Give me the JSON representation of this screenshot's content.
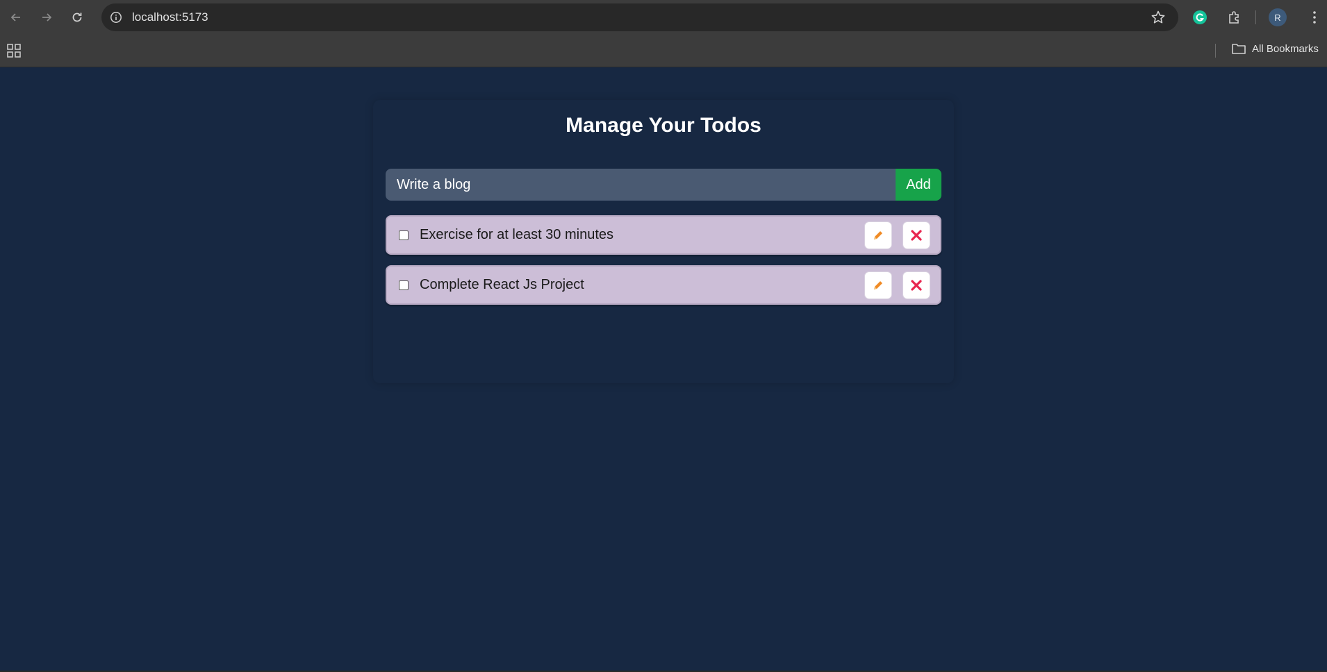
{
  "browser": {
    "url": "localhost:5173",
    "bookmarks_label": "All Bookmarks",
    "profile_initial": "R"
  },
  "app": {
    "title": "Manage Your Todos",
    "input_value": "Write a blog",
    "add_label": "Add",
    "todos": [
      {
        "text": "Exercise for at least 30 minutes",
        "completed": false
      },
      {
        "text": "Complete React Js Project",
        "completed": false
      }
    ]
  },
  "colors": {
    "page_bg": "#172842",
    "input_bg": "#4a5a72",
    "add_button": "#17a34a",
    "todo_bg": "#ccbed7",
    "edit_icon": "#f08a24",
    "delete_icon": "#e8254f"
  },
  "icons": {
    "edit": "pencil-icon",
    "delete": "close-icon"
  }
}
